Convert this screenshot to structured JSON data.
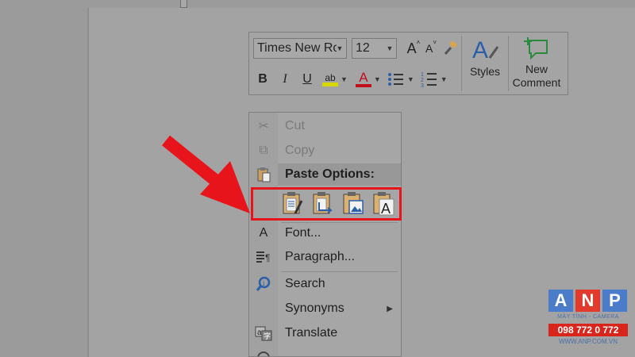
{
  "toolbar": {
    "font_name": "Times New Ro",
    "font_size": "12",
    "styles_label": "Styles",
    "new_comment_line1": "New",
    "new_comment_line2": "Comment",
    "bold_label": "B",
    "italic_label": "I",
    "underline_label": "U",
    "grow_font_label": "A",
    "shrink_font_label": "A",
    "font_color_label": "A",
    "highlight_label": "ab"
  },
  "context_menu": {
    "cut": "Cut",
    "copy": "Copy",
    "paste_options_header": "Paste Options:",
    "font": "Font...",
    "paragraph": "Paragraph...",
    "search": "Search",
    "synonyms": "Synonyms",
    "translate": "Translate",
    "font_icon_glyph": "A"
  },
  "watermark": {
    "letters": [
      "A",
      "N",
      "P"
    ],
    "letter_colors": [
      "#4a7cc9",
      "#e23b2e",
      "#4a7cc9"
    ],
    "tagline": "MÁY TÍNH - CAMERA",
    "phone": "098 772 0 772",
    "website": "WWW.ANP.COM.VN"
  },
  "colors": {
    "highlight_box": "#e8141c",
    "arrow": "#e8141c",
    "font_color_bar": "#c0101b",
    "highlight_bar": "#d8d800"
  }
}
